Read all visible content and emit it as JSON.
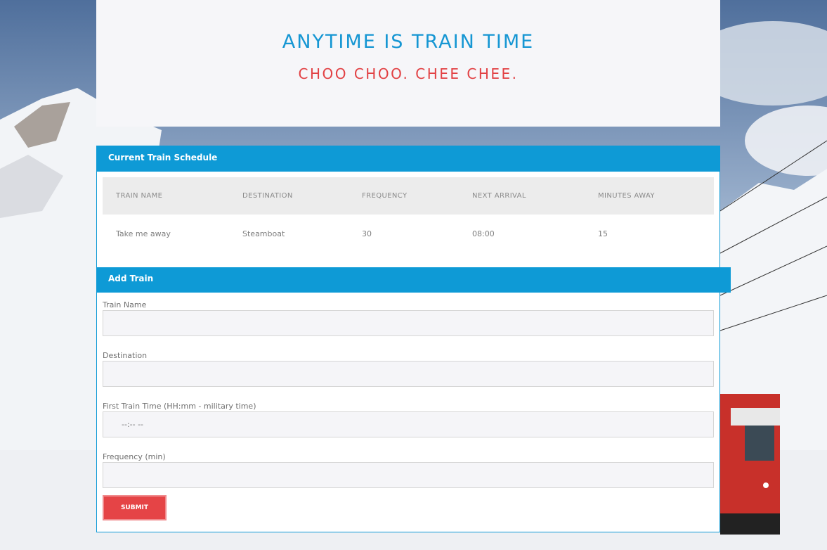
{
  "colors": {
    "title": "#1596d3",
    "subtitle": "#e24144",
    "panel_header": "#0e9ad6",
    "submit": "#e54446"
  },
  "header": {
    "title": "ANYTIME IS TRAIN TIME",
    "subtitle": "CHOO CHOO. CHEE CHEE."
  },
  "schedule": {
    "heading": "Current Train Schedule",
    "columns": [
      "TRAIN NAME",
      "DESTINATION",
      "FREQUENCY",
      "NEXT ARRIVAL",
      "MINUTES AWAY"
    ],
    "rows": [
      [
        "Take me away",
        "Steamboat",
        "30",
        "08:00",
        "15"
      ]
    ]
  },
  "add_train": {
    "heading": "Add Train",
    "train_name_label": "Train Name",
    "destination_label": "Destination",
    "first_time_label": "First Train Time (HH:mm - military time)",
    "first_time_value": "--:-- --",
    "frequency_label": "Frequency (min)",
    "submit_label": "SUBMIT"
  }
}
